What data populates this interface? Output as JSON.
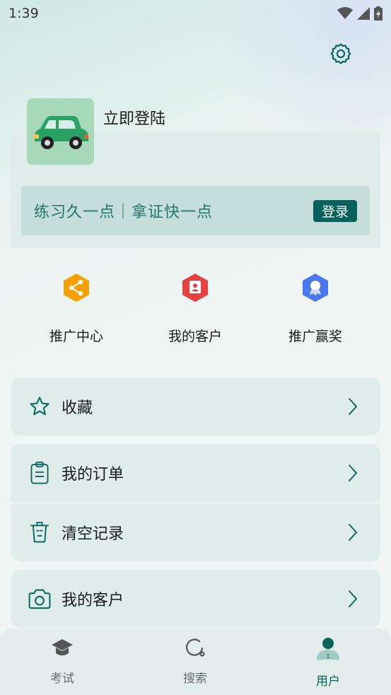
{
  "status": {
    "time": "1:39"
  },
  "profile": {
    "login_title": "立即登陆",
    "slogan": "练习久一点｜拿证快一点",
    "login_button": "登录"
  },
  "quick_actions": [
    {
      "label": "推广中心",
      "icon": "share-icon",
      "color": "#f5a000"
    },
    {
      "label": "我的客户",
      "icon": "customer-icon",
      "color": "#e84040"
    },
    {
      "label": "推广赢奖",
      "icon": "award-icon",
      "color": "#4a78f0"
    }
  ],
  "menu": [
    {
      "label": "收藏",
      "icon": "star-icon"
    },
    {
      "label": "我的订单",
      "icon": "clipboard-icon"
    },
    {
      "label": "清空记录",
      "icon": "trash-icon"
    },
    {
      "label": "我的客户",
      "icon": "camera-icon"
    }
  ],
  "nav": [
    {
      "label": "考试",
      "icon": "graduation-cap-icon"
    },
    {
      "label": "搜索",
      "icon": "search-icon"
    },
    {
      "label": "用户",
      "icon": "user-icon",
      "active": true
    }
  ],
  "colors": {
    "accent": "#06625a",
    "teal_text": "#22756b",
    "card_bg": "#e0ecea"
  }
}
